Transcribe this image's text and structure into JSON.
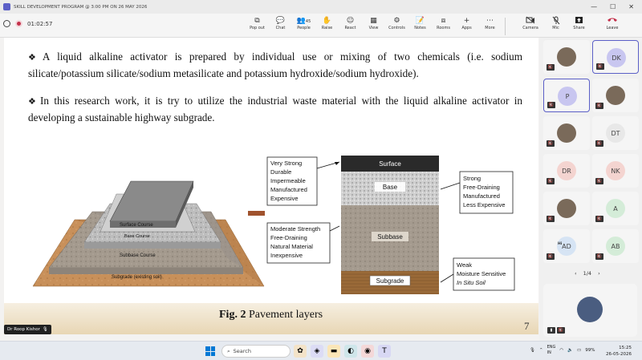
{
  "window": {
    "title": "SKILL DEVELOPMENT PROGRAM @ 3:00 PM ON 26 MAY 2026",
    "min": "—",
    "max": "☐",
    "close": "✕"
  },
  "meeting": {
    "timer": "01:02:57",
    "tools": [
      {
        "label": "Pop out",
        "icon": "⧉"
      },
      {
        "label": "Chat",
        "icon": "💬"
      },
      {
        "label": "People",
        "icon": "👥",
        "count": "45"
      },
      {
        "label": "Raise",
        "icon": "✋"
      },
      {
        "label": "React",
        "icon": "☺"
      },
      {
        "label": "View",
        "icon": "▦"
      },
      {
        "label": "Controls",
        "icon": "⚙"
      },
      {
        "label": "Notes",
        "icon": "📝"
      },
      {
        "label": "Rooms",
        "icon": "⧈"
      },
      {
        "label": "Apps",
        "icon": "+"
      },
      {
        "label": "More",
        "icon": "⋯"
      }
    ],
    "camera": "Camera",
    "mic": "Mic",
    "share": "Share",
    "leave": "Leave"
  },
  "slide": {
    "bullet1": "A liquid alkaline activator is prepared by individual use or mixing of two chemicals (i.e. sodium silicate/potassium silicate/sodium metasilicate and potassium hydroxide/sodium hydroxide).",
    "bullet2": "In this research work, it is try to utilize the industrial waste material with the liquid alkaline activator in developing a sustainable highway subgrade.",
    "bullet_mark": "❖",
    "figure": {
      "left_layers": {
        "surface": "Surface Course",
        "base": "Base Course",
        "subbase": "Subbase Course",
        "subgrade": "Subgrade (existing soil)"
      },
      "box_surface": [
        "Very Strong",
        "Durable",
        "Impermeable",
        "Manufactured",
        "Expensive"
      ],
      "box_subbase": [
        "Moderate Strength",
        "Free-Draining",
        "Natural Material",
        "Inexpensive"
      ],
      "box_base": [
        "Strong",
        "Free-Draining",
        "Manufactured",
        "Less Expensive"
      ],
      "box_subgrade": [
        "Weak",
        "Moisture Sensitive",
        "In Situ Soil"
      ],
      "layers": {
        "surface": "Surface",
        "base": "Base",
        "subbase": "Subbase",
        "subgrade": "Subgrade"
      }
    },
    "caption_bold": "Fig. 2",
    "caption_rest": " Pavement layers",
    "page": "7",
    "presenter": "Dr Roop Kishor"
  },
  "participants": [
    {
      "initials": "",
      "photo": true
    },
    {
      "initials": "DK",
      "color": "#c8c6f0",
      "selected": true
    },
    {
      "initials": "P",
      "color": "#c8c6f0",
      "selected": true
    },
    {
      "initials": "",
      "photo": true
    },
    {
      "initials": "",
      "photo": true
    },
    {
      "initials": "DT",
      "color": "#e8e8e8"
    },
    {
      "initials": "DR",
      "color": "#f4d4d0"
    },
    {
      "initials": "NK",
      "color": "#f4d4d0"
    },
    {
      "initials": "",
      "photo": true
    },
    {
      "initials": "A",
      "color": "#d4ecd8"
    },
    {
      "initials": "AD",
      "color": "#d6e4f4",
      "name": "Hi"
    },
    {
      "initials": "AB",
      "color": "#d4ecd8"
    }
  ],
  "pager": {
    "label": "1/4",
    "prev": "‹",
    "next": "›"
  },
  "taskbar": {
    "search": "Search",
    "lang1": "ENG",
    "lang2": "IN",
    "battery": "99%",
    "time": "15:25",
    "date": "26-05-2026"
  }
}
